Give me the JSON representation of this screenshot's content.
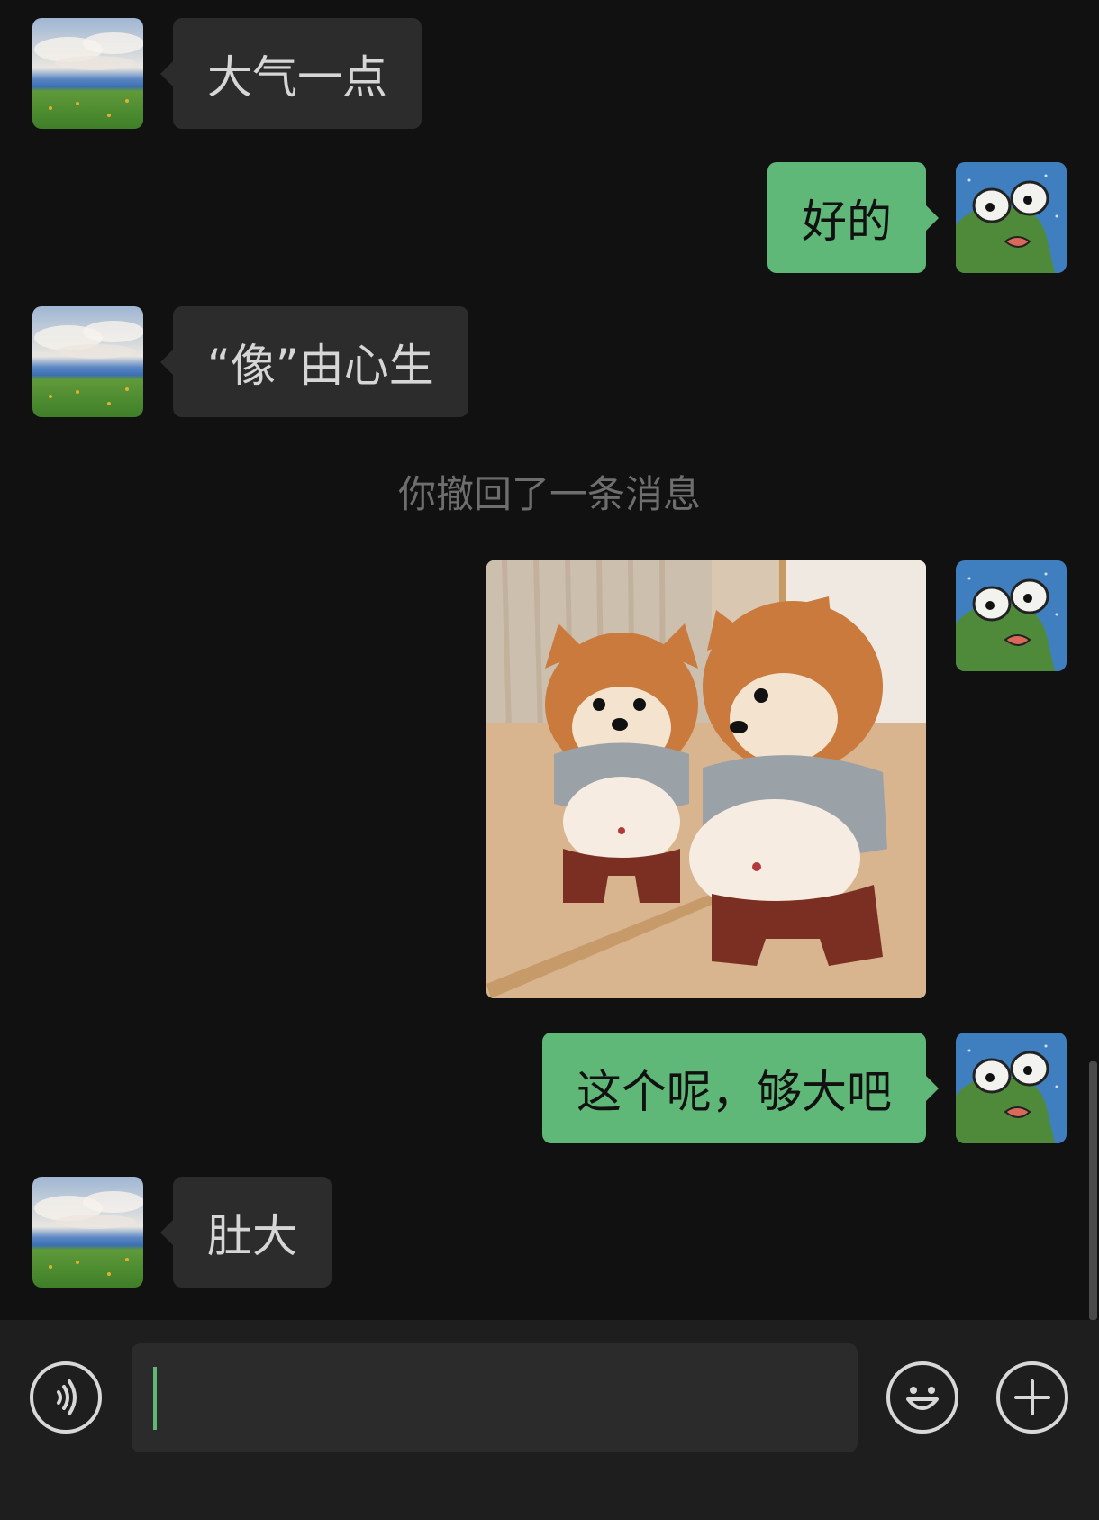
{
  "messages": [
    {
      "side": "received",
      "text": "大气一点"
    },
    {
      "side": "sent",
      "text": "好的"
    },
    {
      "side": "received",
      "text": "“像”由心生"
    },
    {
      "side": "system",
      "text": "你撤回了一条消息"
    },
    {
      "side": "sent",
      "type": "image",
      "image_description_icon": "shiba-dogs-mirror-photo"
    },
    {
      "side": "sent",
      "text": "这个呢，够大吧"
    },
    {
      "side": "received",
      "text": "肚大"
    }
  ],
  "input": {
    "value": "",
    "left_icon": "voice-icon",
    "emoji_icon": "emoji-icon",
    "more_icon": "plus-icon"
  },
  "colors": {
    "background": "#111111",
    "received_bubble": "#2c2c2c",
    "sent_bubble": "#5fb877",
    "system_text": "#6e6e6e",
    "input_bar": "#1e1e1e",
    "caret": "#5fb877"
  }
}
